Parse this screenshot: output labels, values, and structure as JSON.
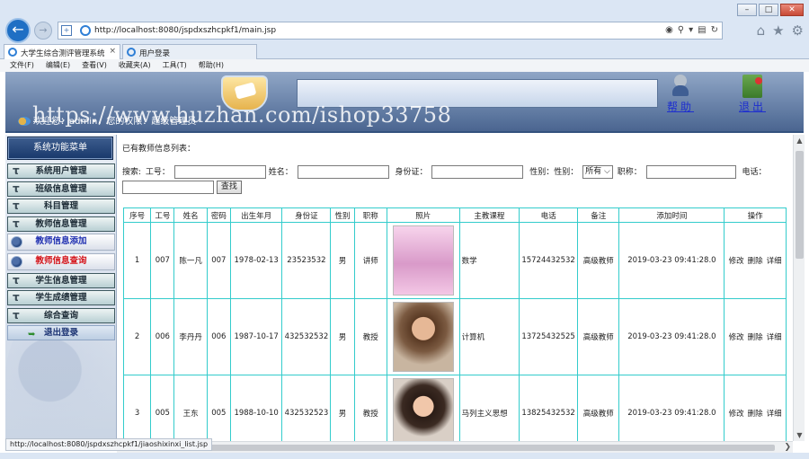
{
  "browser": {
    "window_buttons": {
      "minimize": "–",
      "maximize": "□",
      "close": "✕"
    },
    "url": "http://localhost:8080/jspdxszhcpkf1/main.jsp",
    "tabs": [
      {
        "label": "大学生综合测评管理系统",
        "active": true,
        "close": "×"
      },
      {
        "label": "用户登录",
        "active": false
      }
    ],
    "menu": [
      "文件(F)",
      "编辑(E)",
      "查看(V)",
      "收藏夹(A)",
      "工具(T)",
      "帮助(H)"
    ],
    "status_url": "http://localhost:8080/jspdxszhcpkf1/jiaoshixinxi_list.jsp",
    "icons": {
      "back": "back-arrow-icon",
      "forward": "forward-arrow-icon",
      "home": "home-icon",
      "favorites": "star-icon",
      "settings": "gear-icon"
    }
  },
  "header": {
    "help_label": "帮助",
    "exit_label": "退出",
    "welcome": "欢迎您：admin，您的权限：超级管理员"
  },
  "watermark": "https://www.huzhan.com/ishop33758",
  "sidebar": {
    "title": "系统功能菜单",
    "items": [
      {
        "label": "系统用户管理",
        "type": "group"
      },
      {
        "label": "班级信息管理",
        "type": "group"
      },
      {
        "label": "科目管理",
        "type": "group"
      },
      {
        "label": "教师信息管理",
        "type": "group"
      },
      {
        "label": "教师信息添加",
        "type": "sub",
        "color": "#1f2fb0"
      },
      {
        "label": "教师信息查询",
        "type": "sub",
        "color": "#d4141a"
      },
      {
        "label": "学生信息管理",
        "type": "group"
      },
      {
        "label": "学生成绩管理",
        "type": "group"
      },
      {
        "label": "综合查询",
        "type": "group"
      },
      {
        "label": "退出登录",
        "type": "logout"
      }
    ]
  },
  "content": {
    "list_title": "已有教师信息列表：",
    "search": {
      "prefix": "搜索:",
      "gonghao": "工号：",
      "name": "姓名：",
      "idcard": "身份证：",
      "gender_label": "性别：性别：",
      "gender_value": "所有",
      "title": "职称：",
      "phone": "电话：",
      "button": "查找"
    },
    "table": {
      "headers": [
        "序号",
        "工号",
        "姓名",
        "密码",
        "出生年月",
        "身份证",
        "性别",
        "职称",
        "照片",
        "主教课程",
        "电话",
        "备注",
        "添加时间",
        "操作"
      ],
      "ops": {
        "edit": "修改",
        "delete": "删除",
        "detail": "详细"
      },
      "rows": [
        {
          "seq": "1",
          "gonghao": "007",
          "name": "陈一凡",
          "password": "007",
          "birth": "1978-02-13",
          "idcard": "23523532",
          "gender": "男",
          "title": "讲师",
          "course": "数学",
          "phone": "15724432532",
          "remark": "高级教师",
          "added": "2019-03-23 09:41:28.0"
        },
        {
          "seq": "2",
          "gonghao": "006",
          "name": "李丹丹",
          "password": "006",
          "birth": "1987-10-17",
          "idcard": "432532532",
          "gender": "男",
          "title": "教授",
          "course": "计算机",
          "phone": "13725432525",
          "remark": "高级教师",
          "added": "2019-03-23 09:41:28.0"
        },
        {
          "seq": "3",
          "gonghao": "005",
          "name": "王东",
          "password": "005",
          "birth": "1988-10-10",
          "idcard": "432532523",
          "gender": "男",
          "title": "教授",
          "course": "马列主义思想",
          "phone": "13825432532",
          "remark": "高级教师",
          "added": "2019-03-23 09:41:28.0"
        }
      ]
    }
  }
}
